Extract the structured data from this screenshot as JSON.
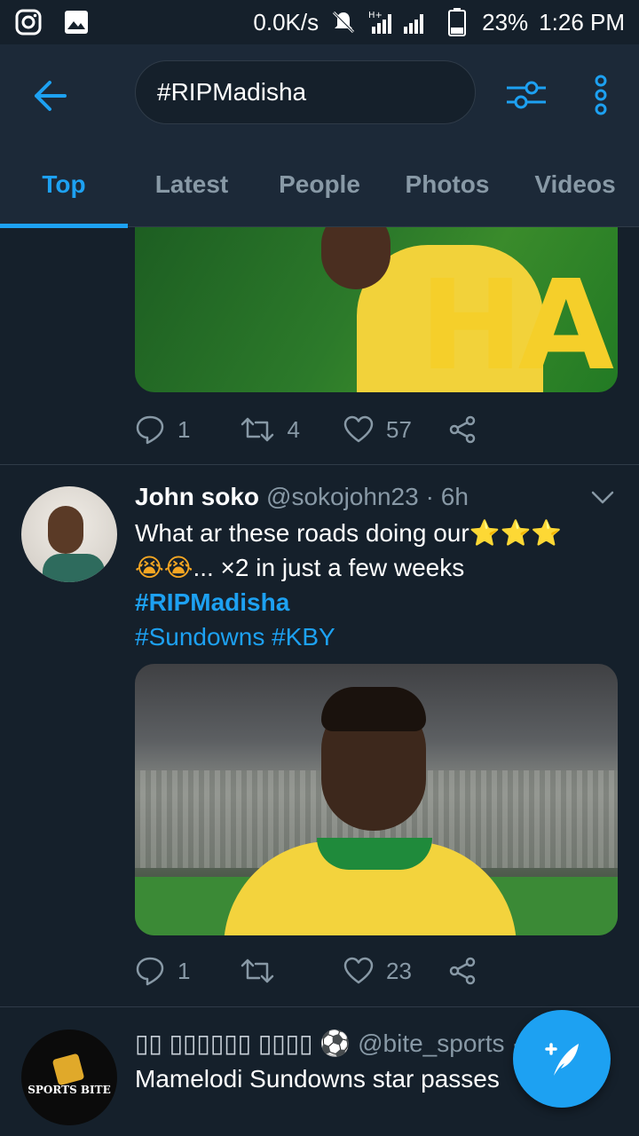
{
  "status_bar": {
    "network_speed": "0.0K/s",
    "battery": "23%",
    "time": "1:26 PM",
    "signal_label": "H+"
  },
  "search": {
    "query": "#RIPMadisha"
  },
  "tabs": [
    {
      "label": "Top",
      "active": true
    },
    {
      "label": "Latest",
      "active": false
    },
    {
      "label": "People",
      "active": false
    },
    {
      "label": "Photos",
      "active": false
    },
    {
      "label": "Videos",
      "active": false
    }
  ],
  "tweets": [
    {
      "media_text": "HA",
      "replies": "1",
      "retweets": "4",
      "likes": "57"
    },
    {
      "name": "John soko",
      "handle": "@sokojohn23",
      "time": "· 6h",
      "text_line1": "What ar these roads doing our",
      "text_line1_emoji": "⭐⭐⭐",
      "text_line2_emoji": "😭😭",
      "text_line2": "... ×2 in just a few weeks",
      "hashtag1": "#RIPMadisha",
      "hashtags2": "#Sundowns #KBY",
      "replies": "1",
      "retweets": "",
      "likes": "23"
    },
    {
      "name": "▯▯ ▯▯▯▯▯▯ ▯▯▯▯ ⚽",
      "handle": "@bite_sports · 5",
      "text": "Mamelodi Sundowns star passes",
      "avatar_text": "SPORTS BITE"
    }
  ],
  "colors": {
    "background": "#15202b",
    "header": "#1c2938",
    "accent": "#1da1f2",
    "muted": "#8899a6"
  },
  "icons": [
    "instagram-icon",
    "gallery-icon",
    "mute-icon",
    "signal-icon",
    "battery-icon",
    "back-arrow-icon",
    "filter-icon",
    "more-vertical-icon",
    "reply-icon",
    "retweet-icon",
    "like-icon",
    "share-icon",
    "chevron-down-icon",
    "compose-icon"
  ]
}
